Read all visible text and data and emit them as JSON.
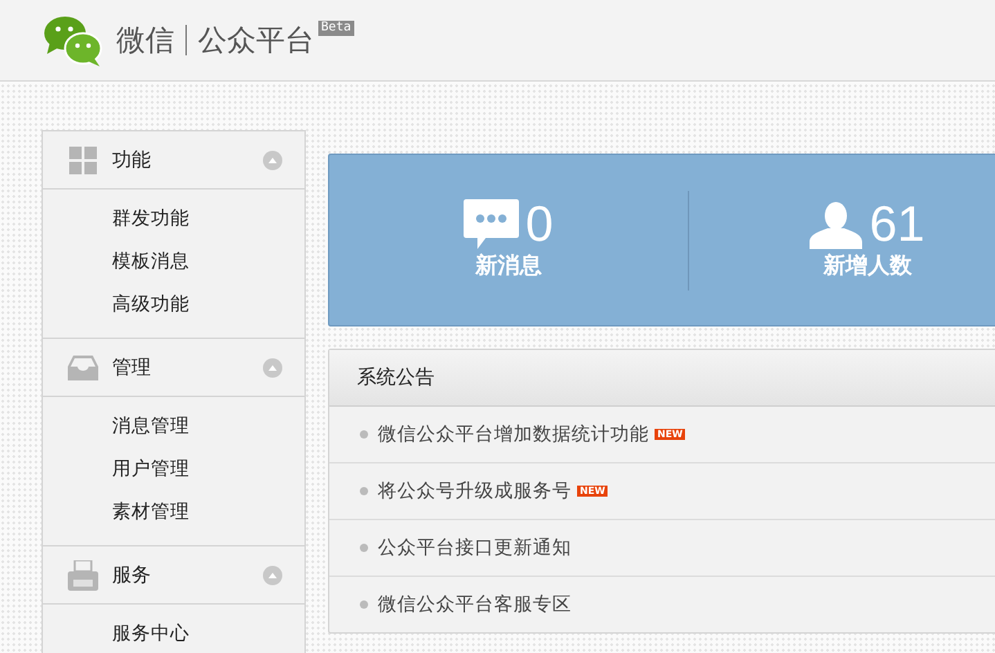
{
  "header": {
    "brand": "微信",
    "product": "公众平台",
    "badge": "Beta"
  },
  "sidebar": [
    {
      "title": "功能",
      "kind": "grid",
      "expanded": true,
      "items": [
        "群发功能",
        "模板消息",
        "高级功能"
      ]
    },
    {
      "title": "管理",
      "kind": "inbox",
      "expanded": true,
      "items": [
        "消息管理",
        "用户管理",
        "素材管理"
      ]
    },
    {
      "title": "服务",
      "kind": "printer",
      "expanded": true,
      "items": [
        "服务中心"
      ]
    }
  ],
  "stats": [
    {
      "kind": "message",
      "value": "0",
      "label": "新消息"
    },
    {
      "kind": "user",
      "value": "61",
      "label": "新增人数"
    }
  ],
  "notices": {
    "title": "系统公告",
    "items": [
      {
        "text": "微信公众平台增加数据统计功能",
        "badge": "NEW"
      },
      {
        "text": "将公众号升级成服务号",
        "badge": "NEW"
      },
      {
        "text": "公众平台接口更新通知"
      },
      {
        "text": "微信公众平台客服专区"
      }
    ]
  }
}
